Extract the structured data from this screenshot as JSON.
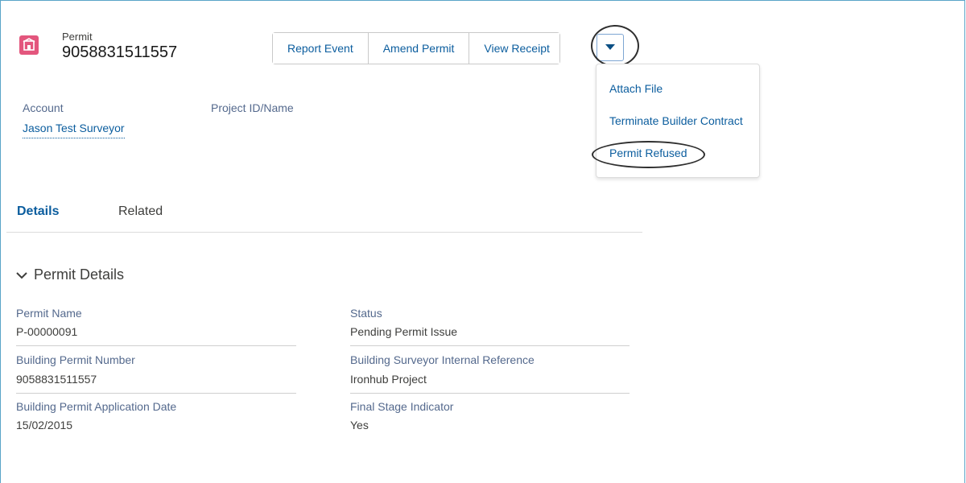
{
  "header": {
    "object_type": "Permit",
    "record_name": "9058831511557",
    "icon": "home-icon",
    "actions": [
      "Report Event",
      "Amend Permit",
      "View Receipt"
    ],
    "more_actions_icon": "caret-down-icon"
  },
  "dropdown_menu": {
    "items": [
      "Attach File",
      "Terminate Builder Contract",
      "Permit Refused"
    ]
  },
  "highlights": {
    "account_label": "Account",
    "account_value": "Jason Test Surveyor",
    "project_label": "Project ID/Name",
    "project_value": ""
  },
  "tabs": [
    "Details",
    "Related"
  ],
  "section": {
    "title": "Permit Details",
    "icon": "chevron-down-icon",
    "fields": [
      {
        "label": "Permit Name",
        "value": "P-00000091"
      },
      {
        "label": "Status",
        "value": "Pending Permit Issue"
      },
      {
        "label": "Building Permit Number",
        "value": "9058831511557"
      },
      {
        "label": "Building Surveyor Internal Reference",
        "value": "Ironhub Project"
      },
      {
        "label": "Building Permit Application Date",
        "value": "15/02/2015"
      },
      {
        "label": "Final Stage Indicator",
        "value": "Yes"
      }
    ]
  },
  "colors": {
    "link": "#0b5d9e",
    "icon_bg": "#e3567d",
    "frame": "#5aa5c8"
  }
}
